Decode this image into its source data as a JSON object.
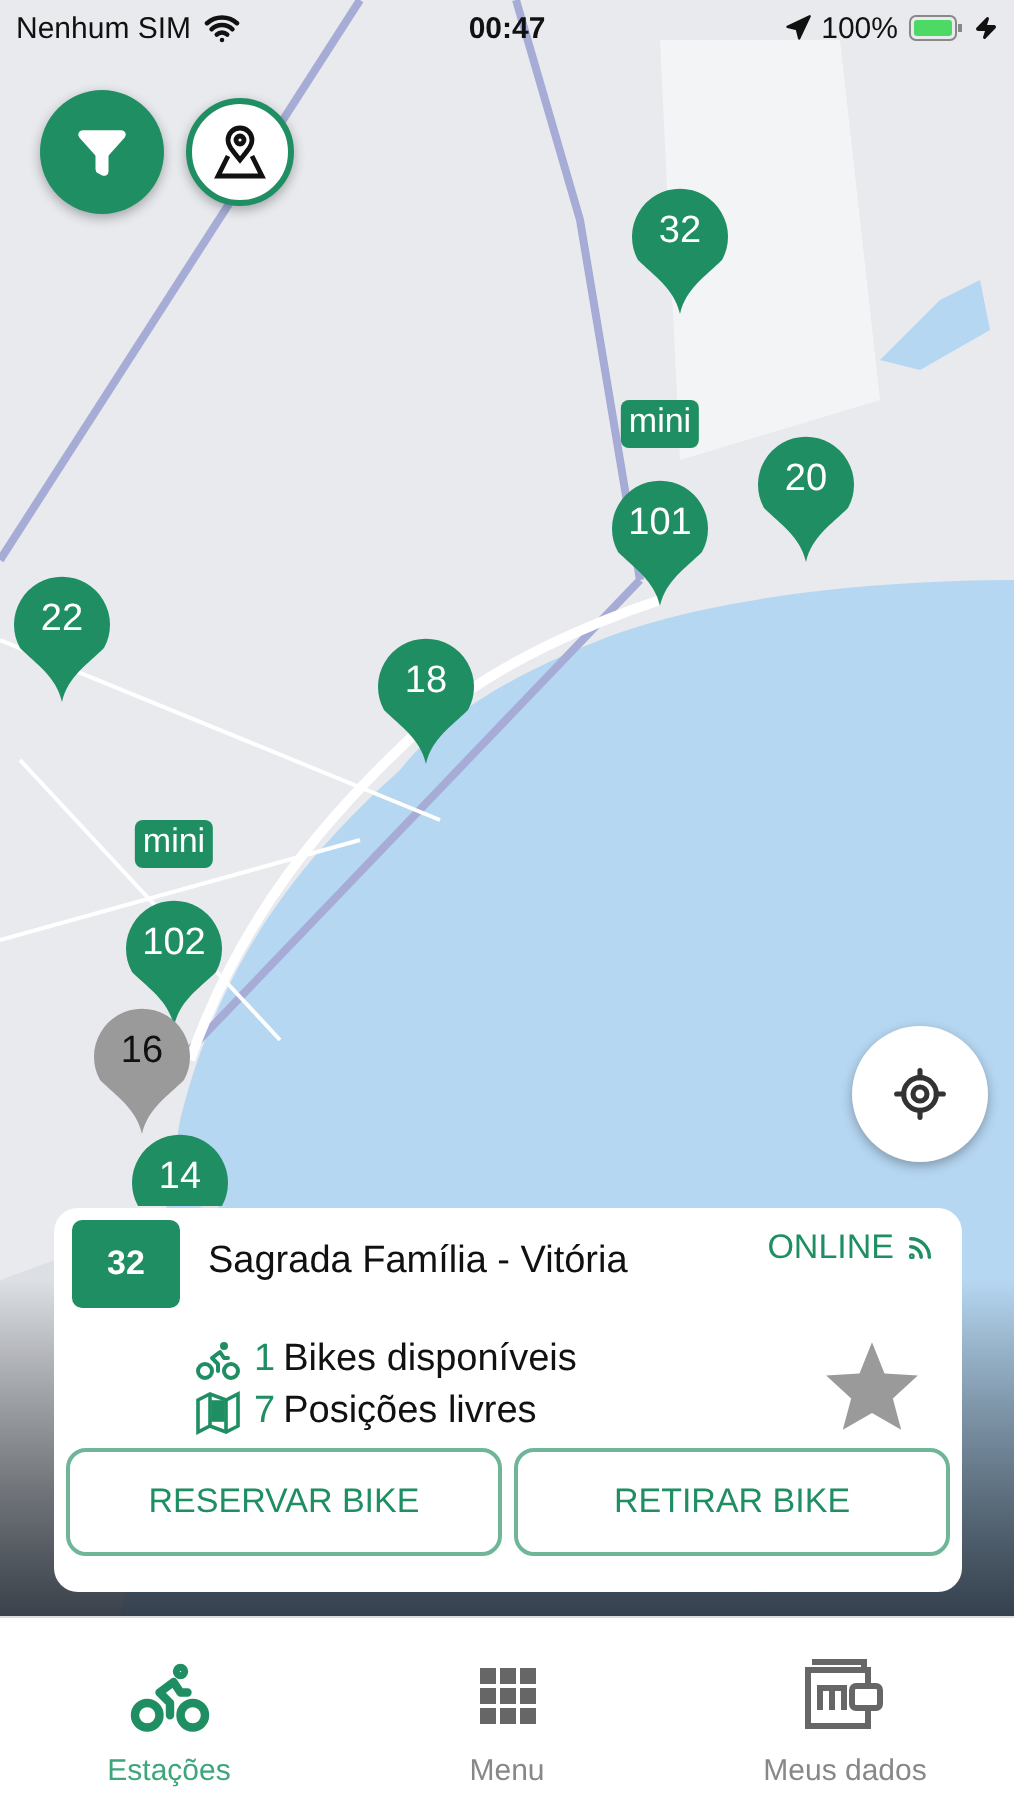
{
  "status_bar": {
    "carrier": "Nenhum SIM",
    "time": "00:47",
    "battery": "100%"
  },
  "map": {
    "kind": "picture",
    "pins": [
      {
        "number": "32",
        "kind": "active"
      },
      {
        "number": "101",
        "kind": "active",
        "badge": "mini"
      },
      {
        "number": "20",
        "kind": "active"
      },
      {
        "number": "22",
        "kind": "active"
      },
      {
        "number": "18",
        "kind": "active"
      },
      {
        "number": "102",
        "kind": "active",
        "badge": "mini"
      },
      {
        "number": "16",
        "kind": "inactive"
      },
      {
        "number": "14",
        "kind": "active"
      }
    ]
  },
  "station_card": {
    "number": "32",
    "name": "Sagrada Família - Vitória",
    "status": "ONLINE",
    "favorite": false,
    "stats": [
      {
        "kind": "bikes",
        "count": "1",
        "label": "Bikes disponíveis"
      },
      {
        "kind": "docks",
        "count": "7",
        "label": "Posições livres"
      }
    ],
    "buttons": [
      "RESERVAR BIKE",
      "RETIRAR BIKE"
    ]
  },
  "tab_bar": [
    {
      "kind": "stations",
      "label": "Estações",
      "selected": true
    },
    {
      "kind": "menu",
      "label": "Menu",
      "selected": false
    },
    {
      "kind": "wallet",
      "label": "Meus dados",
      "selected": false
    }
  ]
}
